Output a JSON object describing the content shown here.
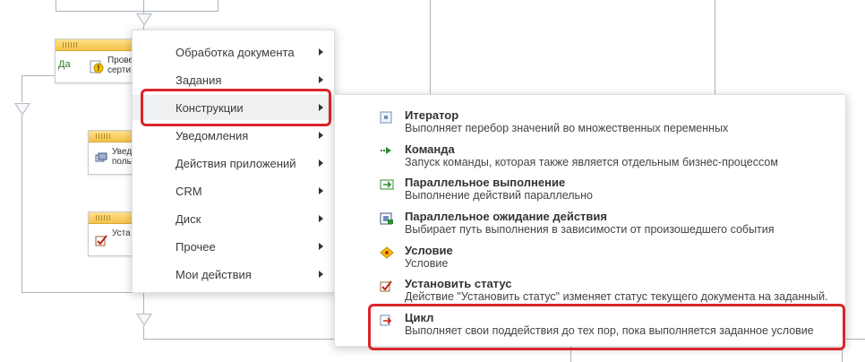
{
  "workflow": {
    "yes_label": "Да",
    "block1_text": [
      "Прове",
      "серти"
    ],
    "block2_text": [
      "Увед",
      "поль"
    ],
    "block3_text": [
      "Уста"
    ]
  },
  "menu": {
    "items": [
      {
        "label": "Обработка документа",
        "submenu": true
      },
      {
        "label": "Задания",
        "submenu": true
      },
      {
        "label": "Конструкции",
        "submenu": true,
        "active": true
      },
      {
        "label": "Уведомления",
        "submenu": true
      },
      {
        "label": "Действия приложений",
        "submenu": true
      },
      {
        "label": "CRM",
        "submenu": true
      },
      {
        "label": "Диск",
        "submenu": true
      },
      {
        "label": "Прочее",
        "submenu": true
      },
      {
        "label": "Мои действия",
        "submenu": true
      }
    ]
  },
  "submenu": {
    "items": [
      {
        "title": "Итератор",
        "desc": "Выполняет перебор значений во множественных переменных",
        "icon": "iterator-icon"
      },
      {
        "title": "Команда",
        "desc": "Запуск команды, которая также является отдельным бизнес-процессом",
        "icon": "command-icon"
      },
      {
        "title": "Параллельное выполнение",
        "desc": "Выполнение действий параллельно",
        "icon": "parallel-icon"
      },
      {
        "title": "Параллельное ожидание действия",
        "desc": "Выбирает путь выполнения в зависимости от произошедшего события",
        "icon": "parallel-wait-icon"
      },
      {
        "title": "Условие",
        "desc": "Условие",
        "icon": "condition-icon"
      },
      {
        "title": "Установить статус",
        "desc": "Действие \"Установить статус\" изменяет статус текущего документа на заданный.",
        "icon": "set-status-icon"
      },
      {
        "title": "Цикл",
        "desc": "Выполняет свои поддействия до тех пор, пока выполняется заданное условие",
        "icon": "loop-icon"
      }
    ]
  },
  "colors": {
    "highlight": "#d9262a",
    "block_header": "#f4c24a",
    "connector": "#a9b3bd"
  }
}
